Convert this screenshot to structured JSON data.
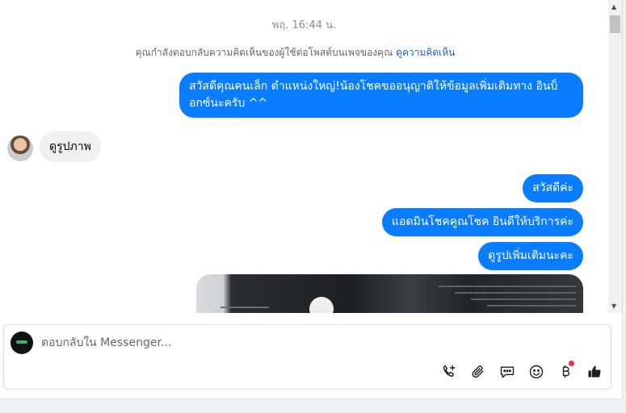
{
  "chat": {
    "timestamp": "พฤ. 16:44 น.",
    "notice": {
      "text": "คุณกำลังตอบกลับความคิดเห็นของผู้ใช้ต่อโพสต์บนเพจของคุณ",
      "link": "ดูความคิดเห็น"
    },
    "messages": [
      {
        "side": "out",
        "text": "สวัสดีคุณคนเล็ก ตำแหน่งใหญ่!น้องโชคขออนุญาติให้ข้อมูลเพิ่มเติมทาง อินบ็อกซ์นะครับ ^^"
      },
      {
        "side": "in",
        "text": "ดูรูปภาพ"
      },
      {
        "side": "out",
        "text": "สวัสดีค่ะ"
      },
      {
        "side": "out",
        "text": "แอดมินโชคคูณโชค ยินดีให้บริการค่ะ"
      },
      {
        "side": "out",
        "text": "ดูรูปเพิ่มเติมนะคะ"
      }
    ]
  },
  "composer": {
    "placeholder": "ตอบกลับใน Messenger...",
    "tools": [
      "phone-plus-icon",
      "paperclip-icon",
      "chat-bubble-icon",
      "smiley-icon",
      "baht-icon",
      "thumbs-up-icon"
    ],
    "notification_color": "#f02849"
  },
  "colors": {
    "bubble_out": "#0a7cff",
    "bubble_in": "#f0f0f0",
    "link": "#1f5fbf"
  }
}
